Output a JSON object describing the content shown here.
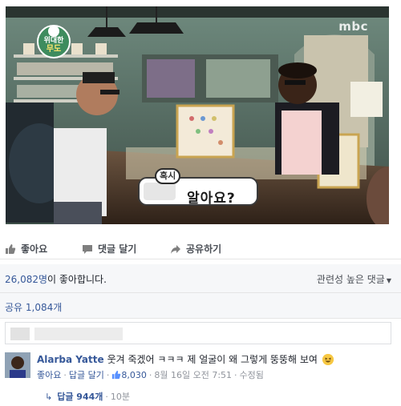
{
  "video": {
    "show_logo_line1": "위대한",
    "show_logo_line2": "무도",
    "channel": "mbc",
    "caption_small": "혹시",
    "caption_big": "알아요?"
  },
  "actions": {
    "like": "좋아요",
    "comment": "댓글 달기",
    "share": "공유하기"
  },
  "stats": {
    "likes_count": "26,082명",
    "likes_suffix": "이 좋아합니다.",
    "sort_label": "관련성 높은 댓글",
    "shares": "공유 1,084개"
  },
  "comment": {
    "author": "Alarba Yatte",
    "text": "웃겨 죽겠어 ㅋㅋㅋ 제 얼굴이 왜 그렇게 뚱뚱해 보여",
    "like_link": "좋아요",
    "reply_link": "답글 달기",
    "like_count": "8,030",
    "timestamp": "8월 16일 오전 7:51",
    "edited": "수정됨",
    "replies_label": "답글 944개",
    "replies_time": "10분"
  },
  "colors": {
    "link": "#365899",
    "meta": "#90949c",
    "panel": "#f6f7f9"
  }
}
